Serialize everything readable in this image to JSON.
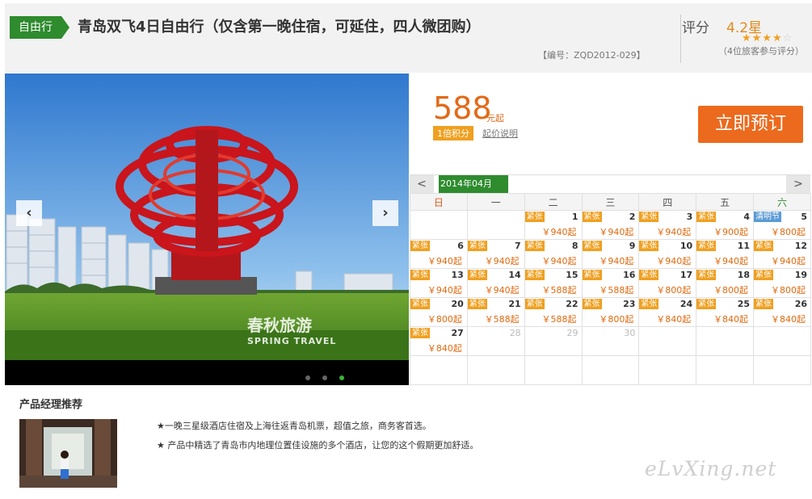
{
  "header": {
    "tag": "自由行",
    "title": "青岛双飞4日自由行（仅含第一晚住宿，可延住，四人微团购）",
    "code": "【编号：ZQD2012-029】",
    "rating_label": "评分",
    "rating_value": "4.2星",
    "rating_stars": 4.2,
    "rating_count": "（4位旅客参与评分）"
  },
  "gallery": {
    "prev_icon": "‹",
    "next_icon": "›",
    "slide_count": 3,
    "active_slide": 3,
    "watermark_cn": "春秋旅游",
    "watermark_en": "SPRING TRAVEL"
  },
  "pricing": {
    "price": "588",
    "unit": "元起",
    "points": "1倍积分",
    "note": "起价说明",
    "book_button": "立即预订"
  },
  "calendar": {
    "prev": "<",
    "next": ">",
    "month": "2014年04月",
    "weekdays": [
      "日",
      "一",
      "二",
      "三",
      "四",
      "五",
      "六"
    ],
    "weeks": [
      [
        {
          "day": "",
          "badge": "",
          "price": ""
        },
        {
          "day": "",
          "badge": "",
          "price": ""
        },
        {
          "day": "1",
          "badge": "紧张",
          "price": "￥940起"
        },
        {
          "day": "2",
          "badge": "紧张",
          "price": "￥940起"
        },
        {
          "day": "3",
          "badge": "紧张",
          "price": "￥940起"
        },
        {
          "day": "4",
          "badge": "紧张",
          "price": "￥900起"
        },
        {
          "day": "5",
          "badge": "清明节",
          "price": "￥800起",
          "holiday": true
        }
      ],
      [
        {
          "day": "6",
          "badge": "紧张",
          "price": "￥940起"
        },
        {
          "day": "7",
          "badge": "紧张",
          "price": "￥940起"
        },
        {
          "day": "8",
          "badge": "紧张",
          "price": "￥940起"
        },
        {
          "day": "9",
          "badge": "紧张",
          "price": "￥940起"
        },
        {
          "day": "10",
          "badge": "紧张",
          "price": "￥940起"
        },
        {
          "day": "11",
          "badge": "紧张",
          "price": "￥940起"
        },
        {
          "day": "12",
          "badge": "紧张",
          "price": "￥940起"
        }
      ],
      [
        {
          "day": "13",
          "badge": "紧张",
          "price": "￥940起"
        },
        {
          "day": "14",
          "badge": "紧张",
          "price": "￥940起"
        },
        {
          "day": "15",
          "badge": "紧张",
          "price": "￥588起"
        },
        {
          "day": "16",
          "badge": "紧张",
          "price": "￥588起"
        },
        {
          "day": "17",
          "badge": "紧张",
          "price": "￥800起"
        },
        {
          "day": "18",
          "badge": "紧张",
          "price": "￥800起"
        },
        {
          "day": "19",
          "badge": "紧张",
          "price": "￥800起"
        }
      ],
      [
        {
          "day": "20",
          "badge": "紧张",
          "price": "￥800起"
        },
        {
          "day": "21",
          "badge": "紧张",
          "price": "￥588起"
        },
        {
          "day": "22",
          "badge": "紧张",
          "price": "￥588起"
        },
        {
          "day": "23",
          "badge": "紧张",
          "price": "￥800起"
        },
        {
          "day": "24",
          "badge": "紧张",
          "price": "￥840起"
        },
        {
          "day": "25",
          "badge": "紧张",
          "price": "￥840起"
        },
        {
          "day": "26",
          "badge": "紧张",
          "price": "￥840起"
        }
      ],
      [
        {
          "day": "27",
          "badge": "紧张",
          "price": "￥840起"
        },
        {
          "day": "28",
          "badge": "",
          "price": "",
          "dim": true
        },
        {
          "day": "29",
          "badge": "",
          "price": "",
          "dim": true
        },
        {
          "day": "30",
          "badge": "",
          "price": "",
          "dim": true
        },
        {
          "day": "",
          "badge": "",
          "price": ""
        },
        {
          "day": "",
          "badge": "",
          "price": ""
        },
        {
          "day": "",
          "badge": "",
          "price": ""
        }
      ],
      [
        {
          "day": "",
          "badge": "",
          "price": ""
        },
        {
          "day": "",
          "badge": "",
          "price": ""
        },
        {
          "day": "",
          "badge": "",
          "price": ""
        },
        {
          "day": "",
          "badge": "",
          "price": ""
        },
        {
          "day": "",
          "badge": "",
          "price": ""
        },
        {
          "day": "",
          "badge": "",
          "price": ""
        },
        {
          "day": "",
          "badge": "",
          "price": ""
        }
      ]
    ]
  },
  "manager": {
    "title": "产品经理推荐",
    "points": [
      "★一晚三星级酒店住宿及上海往返青岛机票，超值之旅，商务客首选。",
      "★ 产品中精选了青岛市内地理位置佳设施的多个酒店，让您的这个假期更加舒适。"
    ]
  },
  "watermark": "eLvXing.net",
  "colors": {
    "accent_green": "#2e8b2e",
    "price_orange": "#e26a17",
    "badge_orange": "#f0a020",
    "button_orange": "#ec6a1d",
    "holiday_blue": "#5b9bd5"
  }
}
